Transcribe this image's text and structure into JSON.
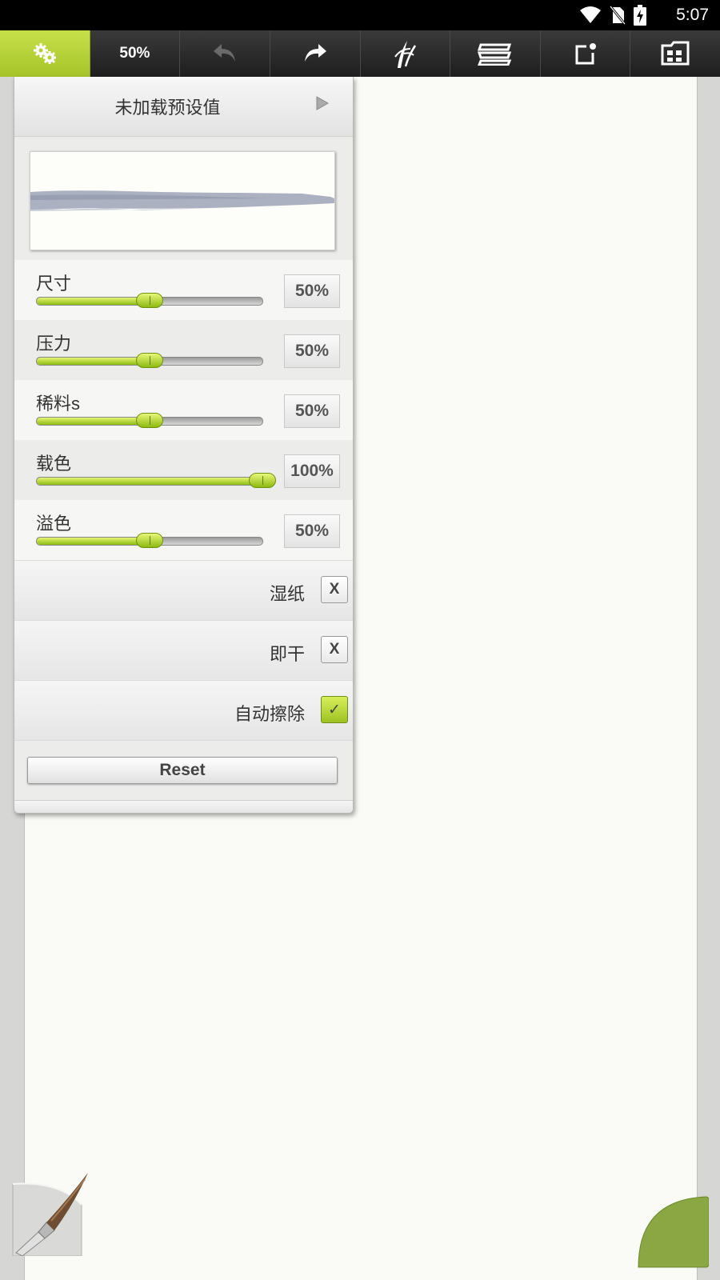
{
  "status_bar": {
    "time": "5:07",
    "icons": [
      "wifi-icon",
      "no-sim-icon",
      "battery-charging-icon"
    ]
  },
  "toolbar": {
    "zoom_label": "50%",
    "buttons": [
      "settings-icon",
      "zoom",
      "undo-icon",
      "redo-icon",
      "brush-select-icon",
      "layers-icon",
      "export-icon",
      "gallery-icon"
    ]
  },
  "panel": {
    "preset_label": "未加载预设值",
    "sliders": [
      {
        "label": "尺寸",
        "value_text": "50%",
        "value": 0.5
      },
      {
        "label": "压力",
        "value_text": "50%",
        "value": 0.5
      },
      {
        "label": "稀料s",
        "value_text": "50%",
        "value": 0.5
      },
      {
        "label": "载色",
        "value_text": "100%",
        "value": 1.0
      },
      {
        "label": "溢色",
        "value_text": "50%",
        "value": 0.5
      }
    ],
    "checks": [
      {
        "label": "湿纸",
        "mark": "X",
        "checked": false
      },
      {
        "label": "即干",
        "mark": "X",
        "checked": false
      },
      {
        "label": "自动擦除",
        "mark": "✓",
        "checked": true
      }
    ],
    "reset_label": "Reset"
  },
  "colors": {
    "accent": "#b3d036",
    "current_color": "#8aa744"
  }
}
